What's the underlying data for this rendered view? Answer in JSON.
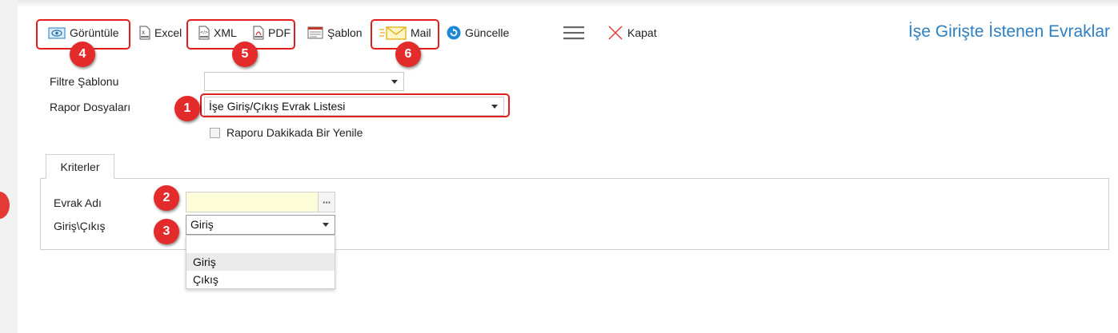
{
  "toolbar": {
    "view_label": "Görüntüle",
    "excel_label": "Excel",
    "xml_label": "XML",
    "pdf_label": "PDF",
    "template_label": "Şablon",
    "mail_label": "Mail",
    "refresh_label": "Güncelle",
    "close_label": "Kapat"
  },
  "page_title": "İşe Girişte İstenen Evraklar",
  "form": {
    "filter_template_label": "Filtre Şablonu",
    "filter_template_value": "",
    "report_files_label": "Rapor Dosyaları",
    "report_files_value": "İşe Giriş/Çıkış Evrak Listesi",
    "auto_refresh_label": "Raporu Dakikada Bir Yenile"
  },
  "criteria": {
    "tab_label": "Kriterler",
    "document_name_label": "Evrak Adı",
    "document_name_value": "",
    "lookup_button_label": "···",
    "entry_exit_label": "Giriş\\Çıkış",
    "entry_exit_value": "Giriş",
    "entry_exit_options": [
      "",
      "Giriş",
      "Çıkış"
    ]
  },
  "annotations": {
    "badge_1": "1",
    "badge_2": "2",
    "badge_3": "3",
    "badge_4": "4",
    "badge_5": "5",
    "badge_6": "6"
  },
  "colors": {
    "title_blue": "#2d7fc1",
    "highlight_red": "#e31c1c",
    "lookup_yellow": "#fdfcd8",
    "dropdown_hover": "#ebebeb"
  }
}
